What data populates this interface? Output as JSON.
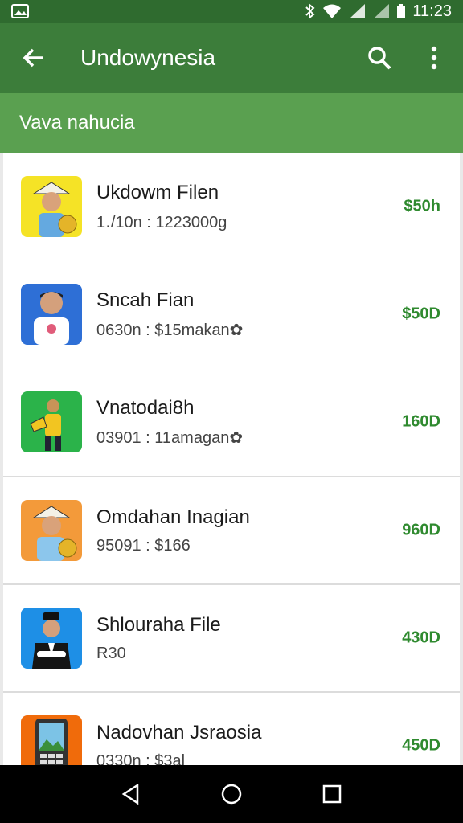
{
  "status": {
    "time": "11:23"
  },
  "app_bar": {
    "title": "Undowynesia"
  },
  "sub_bar": {
    "label": "Vava nahucia"
  },
  "items": [
    {
      "name": "Ukdowm Filen",
      "meta": "1․/10n : 1223000g",
      "price": "$50h",
      "thumb_bg": "#f5e326",
      "icon": "person-hat-coins"
    },
    {
      "name": "Sncah Fian",
      "meta": "0630n : $15makan✿",
      "price": "$50D",
      "thumb_bg": "#2e6fd6",
      "icon": "boy-tshirt"
    },
    {
      "name": "Vnatodai8h",
      "meta": "03901 : 11amagan✿",
      "price": "160D",
      "thumb_bg": "#2bb34a",
      "icon": "person-holding-item"
    },
    {
      "name": "Omdahan Inagian",
      "meta": "95091 : $166",
      "price": "960D",
      "thumb_bg": "#f39a3a",
      "icon": "person-hat-coins"
    },
    {
      "name": "Shlouraha File",
      "meta": "R30",
      "price": "430D",
      "thumb_bg": "#1e8fe6",
      "icon": "man-peci-suit"
    },
    {
      "name": "Nadovhan Jsraosia",
      "meta": "0330n : $3al",
      "price": "450D",
      "thumb_bg": "#f06b0b",
      "icon": "phone-device"
    }
  ]
}
